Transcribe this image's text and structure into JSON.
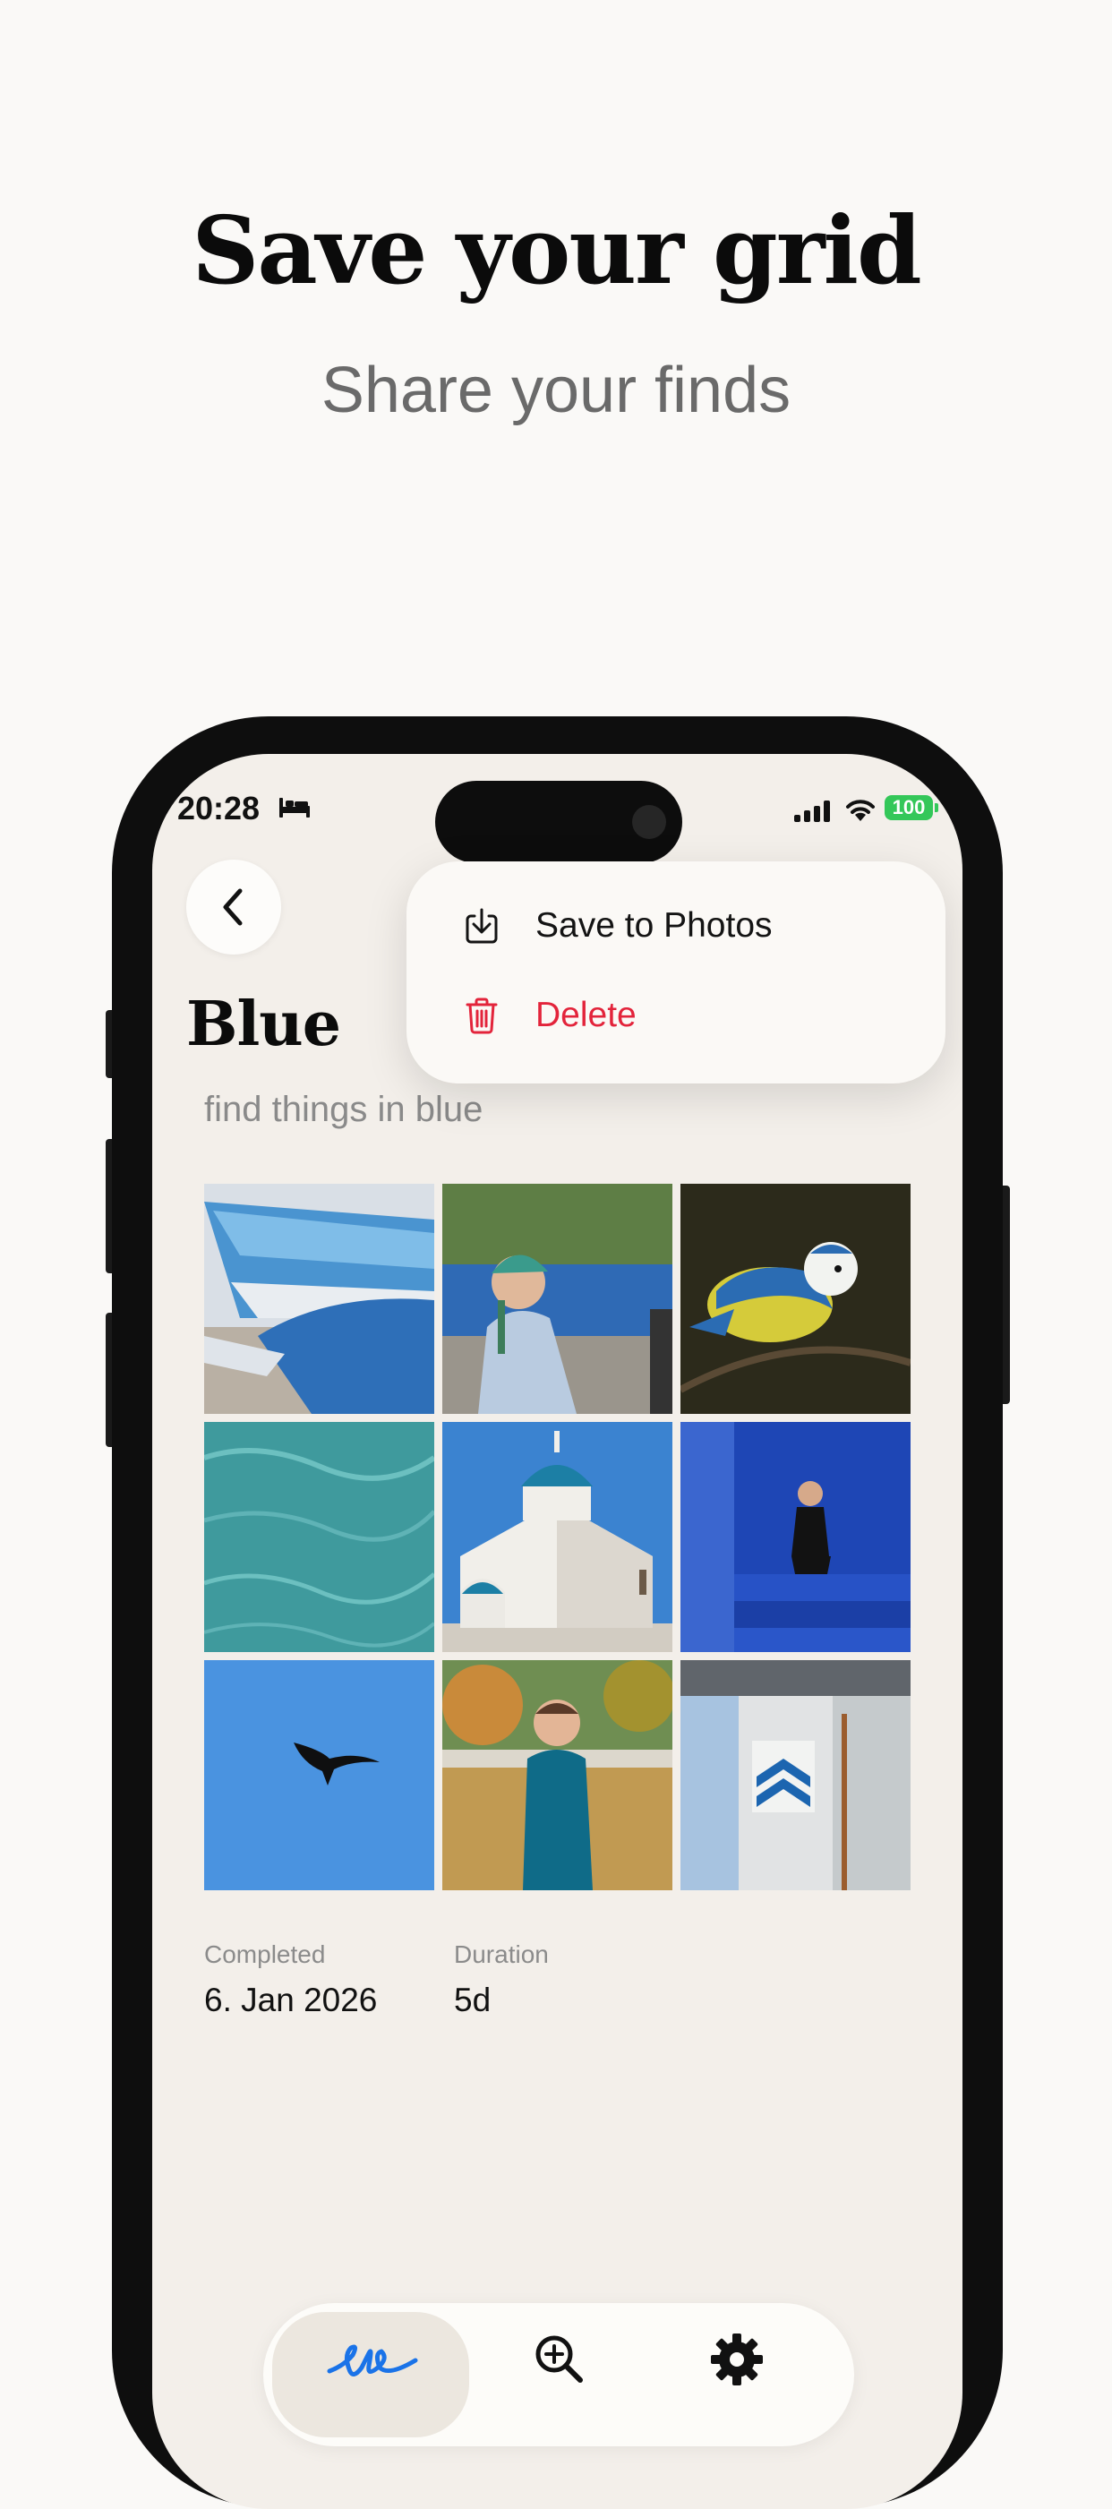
{
  "hero": {
    "title": "Save your grid",
    "subtitle": "Share your finds"
  },
  "status_bar": {
    "time": "20:28",
    "focus_icon": "bed-icon",
    "battery": "100",
    "icons": [
      "signal-icon",
      "wifi-icon",
      "battery-icon"
    ]
  },
  "grid": {
    "title": "Blue",
    "subtitle": "find things in blue",
    "photos": [
      "blue-car-fin",
      "man-with-turban-in-market",
      "blue-tit-bird-on-branch",
      "turquoise-water-surface",
      "white-chapel-blue-dome",
      "person-on-blue-stairs",
      "bird-silhouette-blue-sky",
      "man-in-blue-kurta",
      "building-with-blue-chevron-sign"
    ]
  },
  "menu": {
    "save_label": "Save to Photos",
    "delete_label": "Delete",
    "save_icon": "download-icon",
    "delete_icon": "trash-icon"
  },
  "stats": {
    "completed_label": "Completed",
    "completed_value": "6. Jan 2026",
    "duration_label": "Duration",
    "duration_value": "5d"
  },
  "tabbar": {
    "tabs": [
      "signature-logo-icon",
      "zoom-search-icon",
      "gear-icon"
    ],
    "active": "signature-logo-icon"
  },
  "colors": {
    "accent": "#1a73e8",
    "delete": "#e3243b",
    "battery": "#34c759",
    "background": "#faf9f7",
    "screen": "#f3efea"
  }
}
